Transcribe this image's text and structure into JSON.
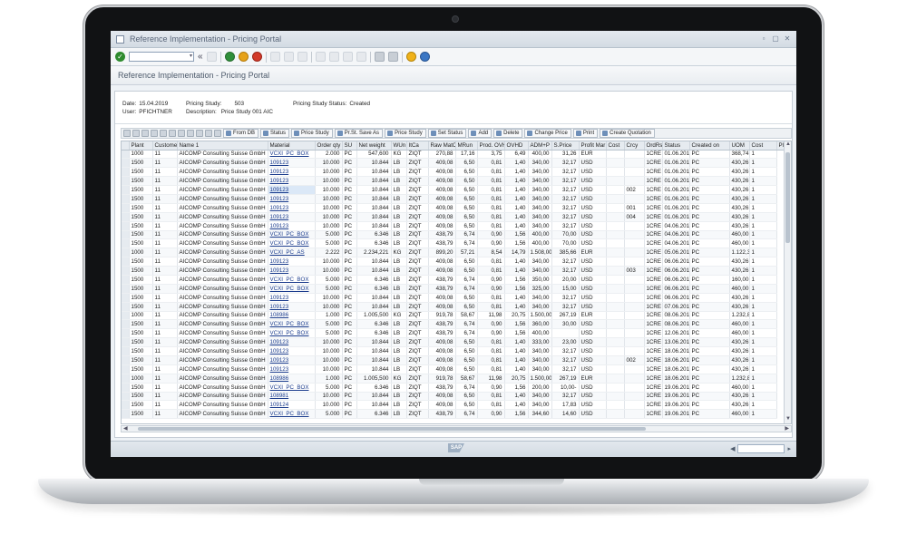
{
  "window": {
    "title": "Reference Implementation - Pricing Portal"
  },
  "page": {
    "title": "Reference Implementation - Pricing Portal"
  },
  "header_info": {
    "date_label": "Date:",
    "date_value": "15.04.2019",
    "user_label": "User:",
    "user_value": "PFICHTNER",
    "study_label": "Pricing Study:",
    "study_value": "503",
    "desc_label": "Description:",
    "desc_value": "Price Study 001 AIC",
    "status_label": "Pricing Study Status:",
    "status_value": "Created"
  },
  "alv_buttons": {
    "from_db": "From DB",
    "status": "Status",
    "price_study": "Price Study",
    "pr_st_save_as": "Pr.St. Save As",
    "price_study_2": "Price Study",
    "set_status": "Set Status",
    "add": "Add",
    "delete": "Delete",
    "change_price": "Change Price",
    "print": "Print",
    "create_quotation": "Create Quotation"
  },
  "columns": [
    "Plant",
    "Customer",
    "Name 1",
    "Material",
    "Order qty",
    "SU",
    "Net weight",
    "WUn",
    "ItCa",
    "Raw MatC",
    "MRun",
    "Prod. OVHD",
    "OVHD",
    "ADM+P",
    "S.Price",
    "Profit Mar",
    "Cost",
    "Crcy",
    "OrdRs",
    "Status",
    "Created on",
    "UOM",
    "Cost",
    "Pl"
  ],
  "rows": [
    [
      "1000",
      "11",
      "AICOMP Consulting Suisse GmbH",
      "VCXI_PC_BOX",
      "2.000",
      "PC",
      "547,600",
      "KG",
      "ZIQT",
      "270,88",
      "17,16",
      "3,75",
      "6,49",
      "400,00",
      "31,26",
      "EUR",
      "",
      "1CRE",
      "01.06.2018",
      "PC",
      "368,74",
      "1"
    ],
    [
      "1500",
      "11",
      "AICOMP Consulting Suisse GmbH",
      "109123",
      "10.000",
      "PC",
      "10.844",
      "LB",
      "ZIQT",
      "409,08",
      "6,50",
      "0,81",
      "1,40",
      "340,00",
      "32,17",
      "USD",
      "",
      "1CRE",
      "01.06.2018",
      "PC",
      "430,26",
      "1"
    ],
    [
      "1500",
      "11",
      "AICOMP Consulting Suisse GmbH",
      "109123",
      "10.000",
      "PC",
      "10.844",
      "LB",
      "ZIQT",
      "409,08",
      "6,50",
      "0,81",
      "1,40",
      "340,00",
      "32,17",
      "USD",
      "",
      "1CRE",
      "01.06.2018",
      "PC",
      "430,26",
      "1"
    ],
    [
      "1500",
      "11",
      "AICOMP Consulting Suisse GmbH",
      "109123",
      "10.000",
      "PC",
      "10.844",
      "LB",
      "ZIQT",
      "409,08",
      "6,50",
      "0,81",
      "1,40",
      "340,00",
      "32,17",
      "USD",
      "",
      "1CRE",
      "01.06.2018",
      "PC",
      "430,26",
      "1"
    ],
    [
      "1500",
      "11",
      "AICOMP Consulting Suisse GmbH",
      "109123",
      "10.000",
      "PC",
      "10.844",
      "LB",
      "ZIQT",
      "409,08",
      "6,50",
      "0,81",
      "1,40",
      "340,00",
      "32,17",
      "USD",
      "002",
      "1CRE",
      "01.06.2018",
      "PC",
      "430,26",
      "1"
    ],
    [
      "1500",
      "11",
      "AICOMP Consulting Suisse GmbH",
      "109123",
      "10.000",
      "PC",
      "10.844",
      "LB",
      "ZIQT",
      "409,08",
      "6,50",
      "0,81",
      "1,40",
      "340,00",
      "32,17",
      "USD",
      "",
      "1CRE",
      "01.06.2018",
      "PC",
      "430,26",
      "1"
    ],
    [
      "1500",
      "11",
      "AICOMP Consulting Suisse GmbH",
      "109123",
      "10.000",
      "PC",
      "10.844",
      "LB",
      "ZIQT",
      "409,08",
      "6,50",
      "0,81",
      "1,40",
      "340,00",
      "32,17",
      "USD",
      "001",
      "1CRE",
      "01.06.2018",
      "PC",
      "430,26",
      "1"
    ],
    [
      "1500",
      "11",
      "AICOMP Consulting Suisse GmbH",
      "109123",
      "10.000",
      "PC",
      "10.844",
      "LB",
      "ZIQT",
      "409,08",
      "6,50",
      "0,81",
      "1,40",
      "340,00",
      "32,17",
      "USD",
      "004",
      "1CRE",
      "01.06.2018",
      "PC",
      "430,26",
      "1"
    ],
    [
      "1500",
      "11",
      "AICOMP Consulting Suisse GmbH",
      "109123",
      "10.000",
      "PC",
      "10.844",
      "LB",
      "ZIQT",
      "409,08",
      "6,50",
      "0,81",
      "1,40",
      "340,00",
      "32,17",
      "USD",
      "",
      "1CRE",
      "04.06.2018",
      "PC",
      "430,26",
      "1"
    ],
    [
      "1500",
      "11",
      "AICOMP Consulting Suisse GmbH",
      "VCXI_PC_BOX",
      "5.000",
      "PC",
      "6.346",
      "LB",
      "ZIQT",
      "438,79",
      "6,74",
      "0,90",
      "1,56",
      "400,00",
      "70,00",
      "USD",
      "",
      "1CRE",
      "04.06.2018",
      "PC",
      "460,00",
      "1"
    ],
    [
      "1500",
      "11",
      "AICOMP Consulting Suisse GmbH",
      "VCXI_PC_BOX",
      "5.000",
      "PC",
      "6.346",
      "LB",
      "ZIQT",
      "438,79",
      "6,74",
      "0,90",
      "1,56",
      "400,00",
      "70,00",
      "USD",
      "",
      "1CRE",
      "04.06.2018",
      "PC",
      "460,00",
      "1"
    ],
    [
      "1000",
      "11",
      "AICOMP Consulting Suisse GmbH",
      "VCXI_PC_AS",
      "2.222",
      "PC",
      "2.234,221",
      "KG",
      "ZIQT",
      "899,20",
      "57,21",
      "8,54",
      "14,79",
      "1.508,00",
      "385,66",
      "EUR",
      "",
      "1CRE",
      "05.06.2018",
      "PC",
      "1.122,34",
      "1"
    ],
    [
      "1500",
      "11",
      "AICOMP Consulting Suisse GmbH",
      "109123",
      "10.000",
      "PC",
      "10.844",
      "LB",
      "ZIQT",
      "409,08",
      "6,50",
      "0,81",
      "1,40",
      "340,00",
      "32,17",
      "USD",
      "",
      "1CRE",
      "06.06.2018",
      "PC",
      "430,26",
      "1"
    ],
    [
      "1500",
      "11",
      "AICOMP Consulting Suisse GmbH",
      "109123",
      "10.000",
      "PC",
      "10.844",
      "LB",
      "ZIQT",
      "409,08",
      "6,50",
      "0,81",
      "1,40",
      "340,00",
      "32,17",
      "USD",
      "003",
      "1CRE",
      "06.06.2018",
      "PC",
      "430,26",
      "1"
    ],
    [
      "1500",
      "11",
      "AICOMP Consulting Suisse GmbH",
      "VCXI_PC_BOX",
      "5.000",
      "PC",
      "6.346",
      "LB",
      "ZIQT",
      "438,79",
      "6,74",
      "0,90",
      "1,56",
      "350,00",
      "20,00",
      "USD",
      "",
      "1CRE",
      "06.06.2018",
      "PC",
      "160,00",
      "1"
    ],
    [
      "1500",
      "11",
      "AICOMP Consulting Suisse GmbH",
      "VCXI_PC_BOX",
      "5.000",
      "PC",
      "6.346",
      "LB",
      "ZIQT",
      "438,79",
      "6,74",
      "0,90",
      "1,56",
      "325,00",
      "15,00",
      "USD",
      "",
      "1CRE",
      "06.06.2018",
      "PC",
      "460,00",
      "1"
    ],
    [
      "1500",
      "11",
      "AICOMP Consulting Suisse GmbH",
      "109123",
      "10.000",
      "PC",
      "10.844",
      "LB",
      "ZIQT",
      "409,08",
      "6,50",
      "0,81",
      "1,40",
      "340,00",
      "32,17",
      "USD",
      "",
      "1CRE",
      "06.06.2018",
      "PC",
      "430,26",
      "1"
    ],
    [
      "1500",
      "11",
      "AICOMP Consulting Suisse GmbH",
      "109123",
      "10.000",
      "PC",
      "10.844",
      "LB",
      "ZIQT",
      "409,08",
      "6,50",
      "0,81",
      "1,40",
      "340,00",
      "32,17",
      "USD",
      "",
      "1CRE",
      "07.06.2018",
      "PC",
      "430,26",
      "1"
    ],
    [
      "1000",
      "11",
      "AICOMP Consulting Suisse GmbH",
      "108986",
      "1.000",
      "PC",
      "1.005,500",
      "KG",
      "ZIQT",
      "919,78",
      "58,67",
      "11,98",
      "20,75",
      "1.500,00",
      "267,19",
      "EUR",
      "",
      "1CRE",
      "08.06.2018",
      "PC",
      "1.232,81",
      "1"
    ],
    [
      "1500",
      "11",
      "AICOMP Consulting Suisse GmbH",
      "VCXI_PC_BOX",
      "5.000",
      "PC",
      "6.346",
      "LB",
      "ZIQT",
      "438,79",
      "6,74",
      "0,90",
      "1,56",
      "360,00",
      "30,00",
      "USD",
      "",
      "1CRE",
      "08.06.2018",
      "PC",
      "460,00",
      "1"
    ],
    [
      "1500",
      "11",
      "AICOMP Consulting Suisse GmbH",
      "VCXI_PC_BOX",
      "5.000",
      "PC",
      "6.346",
      "LB",
      "ZIQT",
      "438,79",
      "6,74",
      "0,90",
      "1,56",
      "400,00",
      "",
      "USD",
      "",
      "1CRE",
      "12.06.2018",
      "PC",
      "460,00",
      "1"
    ],
    [
      "1500",
      "11",
      "AICOMP Consulting Suisse GmbH",
      "109123",
      "10.000",
      "PC",
      "10.844",
      "LB",
      "ZIQT",
      "409,08",
      "6,50",
      "0,81",
      "1,40",
      "333,00",
      "23,00",
      "USD",
      "",
      "1CRE",
      "13.06.2018",
      "PC",
      "430,26",
      "1"
    ],
    [
      "1500",
      "11",
      "AICOMP Consulting Suisse GmbH",
      "109123",
      "10.000",
      "PC",
      "10.844",
      "LB",
      "ZIQT",
      "409,08",
      "6,50",
      "0,81",
      "1,40",
      "340,00",
      "32,17",
      "USD",
      "",
      "1CRE",
      "18.06.2018",
      "PC",
      "430,26",
      "1"
    ],
    [
      "1500",
      "11",
      "AICOMP Consulting Suisse GmbH",
      "109123",
      "10.000",
      "PC",
      "10.844",
      "LB",
      "ZIQT",
      "409,08",
      "6,50",
      "0,81",
      "1,40",
      "340,00",
      "32,17",
      "USD",
      "002",
      "1CRE",
      "18.06.2018",
      "PC",
      "430,26",
      "1"
    ],
    [
      "1500",
      "11",
      "AICOMP Consulting Suisse GmbH",
      "109123",
      "10.000",
      "PC",
      "10.844",
      "LB",
      "ZIQT",
      "409,08",
      "6,50",
      "0,81",
      "1,40",
      "340,00",
      "32,17",
      "USD",
      "",
      "1CRE",
      "18.06.2018",
      "PC",
      "430,26",
      "1"
    ],
    [
      "1000",
      "11",
      "AICOMP Consulting Suisse GmbH",
      "108986",
      "1.000",
      "PC",
      "1.005,500",
      "KG",
      "ZIQT",
      "919,78",
      "58,67",
      "11,98",
      "20,75",
      "1.500,00",
      "267,19",
      "EUR",
      "",
      "1CRE",
      "18.06.2018",
      "PC",
      "1.232,81",
      "1"
    ],
    [
      "1500",
      "11",
      "AICOMP Consulting Suisse GmbH",
      "VCXI_PC_BOX",
      "5.000",
      "PC",
      "6.346",
      "LB",
      "ZIQT",
      "438,79",
      "6,74",
      "0,90",
      "1,56",
      "200,00",
      "10,00-",
      "USD",
      "",
      "1CRE",
      "19.06.2018",
      "PC",
      "460,00",
      "1"
    ],
    [
      "1500",
      "11",
      "AICOMP Consulting Suisse GmbH",
      "108981",
      "10.000",
      "PC",
      "10.844",
      "LB",
      "ZIQT",
      "409,08",
      "6,50",
      "0,81",
      "1,40",
      "340,00",
      "32,17",
      "USD",
      "",
      "1CRE",
      "19.06.2018",
      "PC",
      "430,26",
      "1"
    ],
    [
      "1500",
      "11",
      "AICOMP Consulting Suisse GmbH",
      "109124",
      "10.000",
      "PC",
      "10.844",
      "LB",
      "ZIQT",
      "409,08",
      "6,50",
      "0,81",
      "1,40",
      "340,00",
      "17,83",
      "USD",
      "",
      "1CRE",
      "19.06.2018",
      "PC",
      "430,26",
      "1"
    ],
    [
      "1500",
      "11",
      "AICOMP Consulting Suisse GmbH",
      "VCXI_PC_BOX",
      "5.000",
      "PC",
      "6.346",
      "LB",
      "ZIQT",
      "438,79",
      "6,74",
      "0,90",
      "1,56",
      "344,60",
      "14,60",
      "USD",
      "",
      "1CRE",
      "19.06.2018",
      "PC",
      "460,00",
      "1"
    ]
  ],
  "selected_cell": {
    "row": 4,
    "col": 3
  },
  "colors": {
    "accent_link": "#1a3b8c",
    "selection": "#dbe8f7",
    "frame": "#111214"
  }
}
